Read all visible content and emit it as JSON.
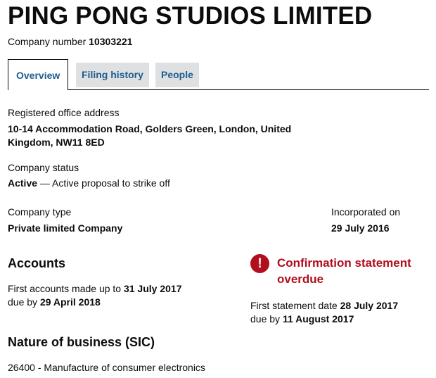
{
  "company": {
    "name": "PING PONG STUDIOS LIMITED",
    "number_label": "Company number",
    "number": "10303221"
  },
  "tabs": [
    {
      "label": "Overview",
      "active": true
    },
    {
      "label": "Filing history",
      "active": false
    },
    {
      "label": "People",
      "active": false
    }
  ],
  "registered_office": {
    "label": "Registered office address",
    "line1": "10-14 Accommodation Road, Golders Green, London, United",
    "line2": "Kingdom, NW11 8ED"
  },
  "status": {
    "label": "Company status",
    "value": "Active",
    "detail": " — Active proposal to strike off"
  },
  "type": {
    "label": "Company type",
    "value": "Private limited Company"
  },
  "incorporated": {
    "label": "Incorporated on",
    "value": "29 July 2016"
  },
  "accounts": {
    "heading": "Accounts",
    "first_label": "First accounts made up to ",
    "first_date": "31 July 2017",
    "due_label": "due by ",
    "due_date": "29 April 2018"
  },
  "confirmation": {
    "icon": "exclamation-icon",
    "title": "Confirmation statement overdue",
    "first_label": "First statement date ",
    "first_date": "28 July 2017",
    "due_label": "due by ",
    "due_date": "11 August 2017",
    "color": "#b10e1e"
  },
  "nature": {
    "heading": "Nature of business (SIC)",
    "item": "26400 - Manufacture of consumer electronics"
  }
}
